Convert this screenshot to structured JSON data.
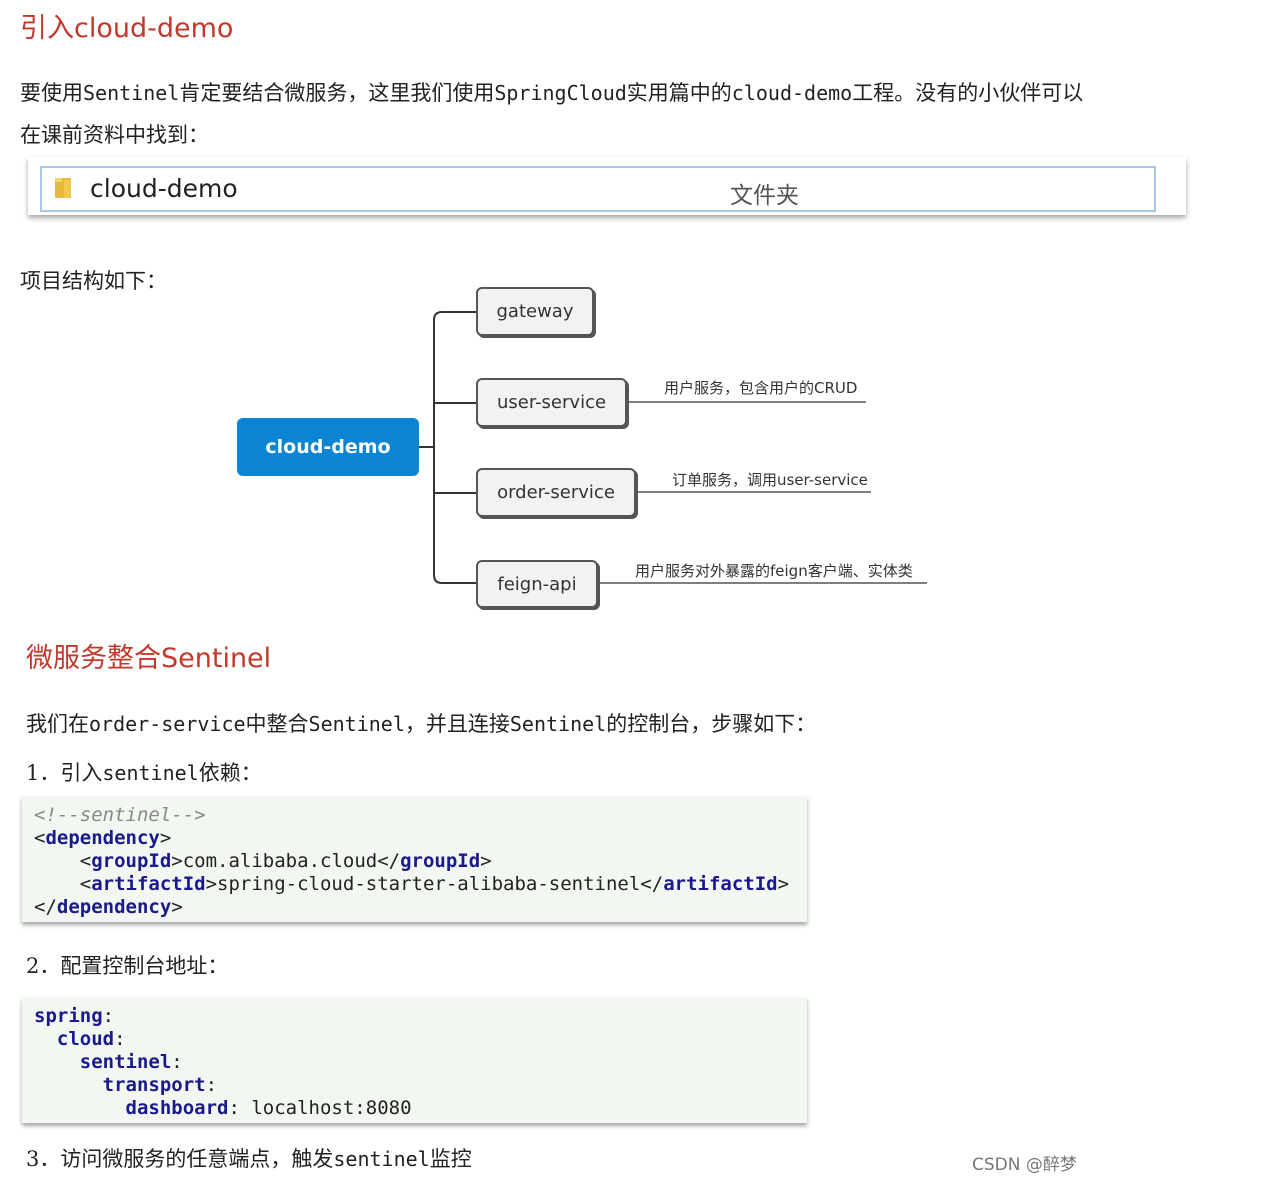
{
  "section1": {
    "title": "引入cloud-demo",
    "intro_line1_a": "要使用",
    "intro_line1_b": "Sentinel",
    "intro_line1_c": "肯定要结合微服务，这里我们使用",
    "intro_line1_d": "SpringCloud",
    "intro_line1_e": "实用篇中的",
    "intro_line1_f": "cloud-demo",
    "intro_line1_g": "工程。没有的小伙伴可以",
    "intro_line2": "在课前资料中找到：",
    "folder": {
      "name": "cloud-demo",
      "type": "文件夹",
      "icon": "folder-icon"
    },
    "structure_label": "项目结构如下："
  },
  "mindmap": {
    "root": "cloud-demo",
    "nodes": [
      {
        "label": "gateway",
        "note": ""
      },
      {
        "label": "user-service",
        "note": "用户服务，包含用户的CRUD"
      },
      {
        "label": "order-service",
        "note": "订单服务，调用user-service"
      },
      {
        "label": "feign-api",
        "note": "用户服务对外暴露的feign客户端、实体类"
      }
    ]
  },
  "section2": {
    "title": "微服务整合Sentinel",
    "intro_a": "我们在",
    "intro_b": "order-service",
    "intro_c": "中整合",
    "intro_d": "Sentinel",
    "intro_e": "，并且连接",
    "intro_f": "Sentinel",
    "intro_g": "的控制台，步骤如下：",
    "step1_a": "1．引入",
    "step1_b": "sentinel",
    "step1_c": "依赖：",
    "code1": {
      "comment": "<!--sentinel-->",
      "dependency_tag": "dependency",
      "groupId_tag": "groupId",
      "groupId_value": "com.alibaba.cloud",
      "artifactId_tag": "artifactId",
      "artifactId_value": "spring-cloud-starter-alibaba-sentinel"
    },
    "step2": "2．配置控制台地址：",
    "code2": {
      "k1": "spring",
      "k2": "cloud",
      "k3": "sentinel",
      "k4": "transport",
      "k5": "dashboard",
      "v5": "localhost:8080"
    },
    "step3_a": "3．访问微服务的任意端点，触发",
    "step3_b": "sentinel",
    "step3_c": "监控"
  },
  "watermark": "CSDN @醉梦"
}
